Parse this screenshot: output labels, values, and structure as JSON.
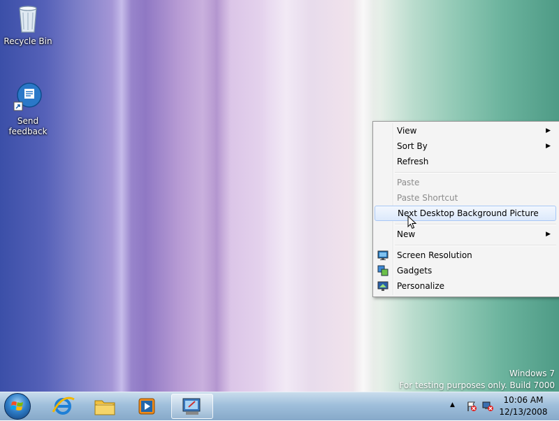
{
  "desktop": {
    "icons": [
      {
        "label": "Recycle Bin",
        "icon": "recycle-bin-icon"
      },
      {
        "label_line1": "Send",
        "label_line2": "feedback",
        "icon": "send-feedback-icon"
      }
    ],
    "watermark": {
      "line1": "Windows 7",
      "line2": "For testing purposes only. Build 7000"
    }
  },
  "context_menu": {
    "items": [
      {
        "label": "View",
        "submenu": true,
        "enabled": true
      },
      {
        "label": "Sort By",
        "submenu": true,
        "enabled": true
      },
      {
        "label": "Refresh",
        "enabled": true
      },
      {
        "label": "Paste",
        "enabled": false
      },
      {
        "label": "Paste Shortcut",
        "enabled": false
      },
      {
        "label": "Next Desktop Background Picture",
        "enabled": true,
        "highlighted": true
      },
      {
        "label": "New",
        "submenu": true,
        "enabled": true
      },
      {
        "label": "Screen Resolution",
        "enabled": true,
        "icon": "screen-resolution-icon"
      },
      {
        "label": "Gadgets",
        "enabled": true,
        "icon": "gadgets-icon"
      },
      {
        "label": "Personalize",
        "enabled": true,
        "icon": "personalize-icon"
      }
    ],
    "submenu_arrow": "▶"
  },
  "taskbar": {
    "buttons": [
      {
        "icon": "start-orb-icon"
      },
      {
        "icon": "internet-explorer-icon"
      },
      {
        "icon": "windows-explorer-icon"
      },
      {
        "icon": "media-player-icon"
      },
      {
        "icon": "control-panel-icon",
        "active": true
      }
    ],
    "tray": {
      "show_hidden_arrow": "▲",
      "icons": [
        "action-center-flag-icon",
        "network-icon"
      ],
      "time": "10:06 AM",
      "date": "12/13/2008"
    }
  }
}
